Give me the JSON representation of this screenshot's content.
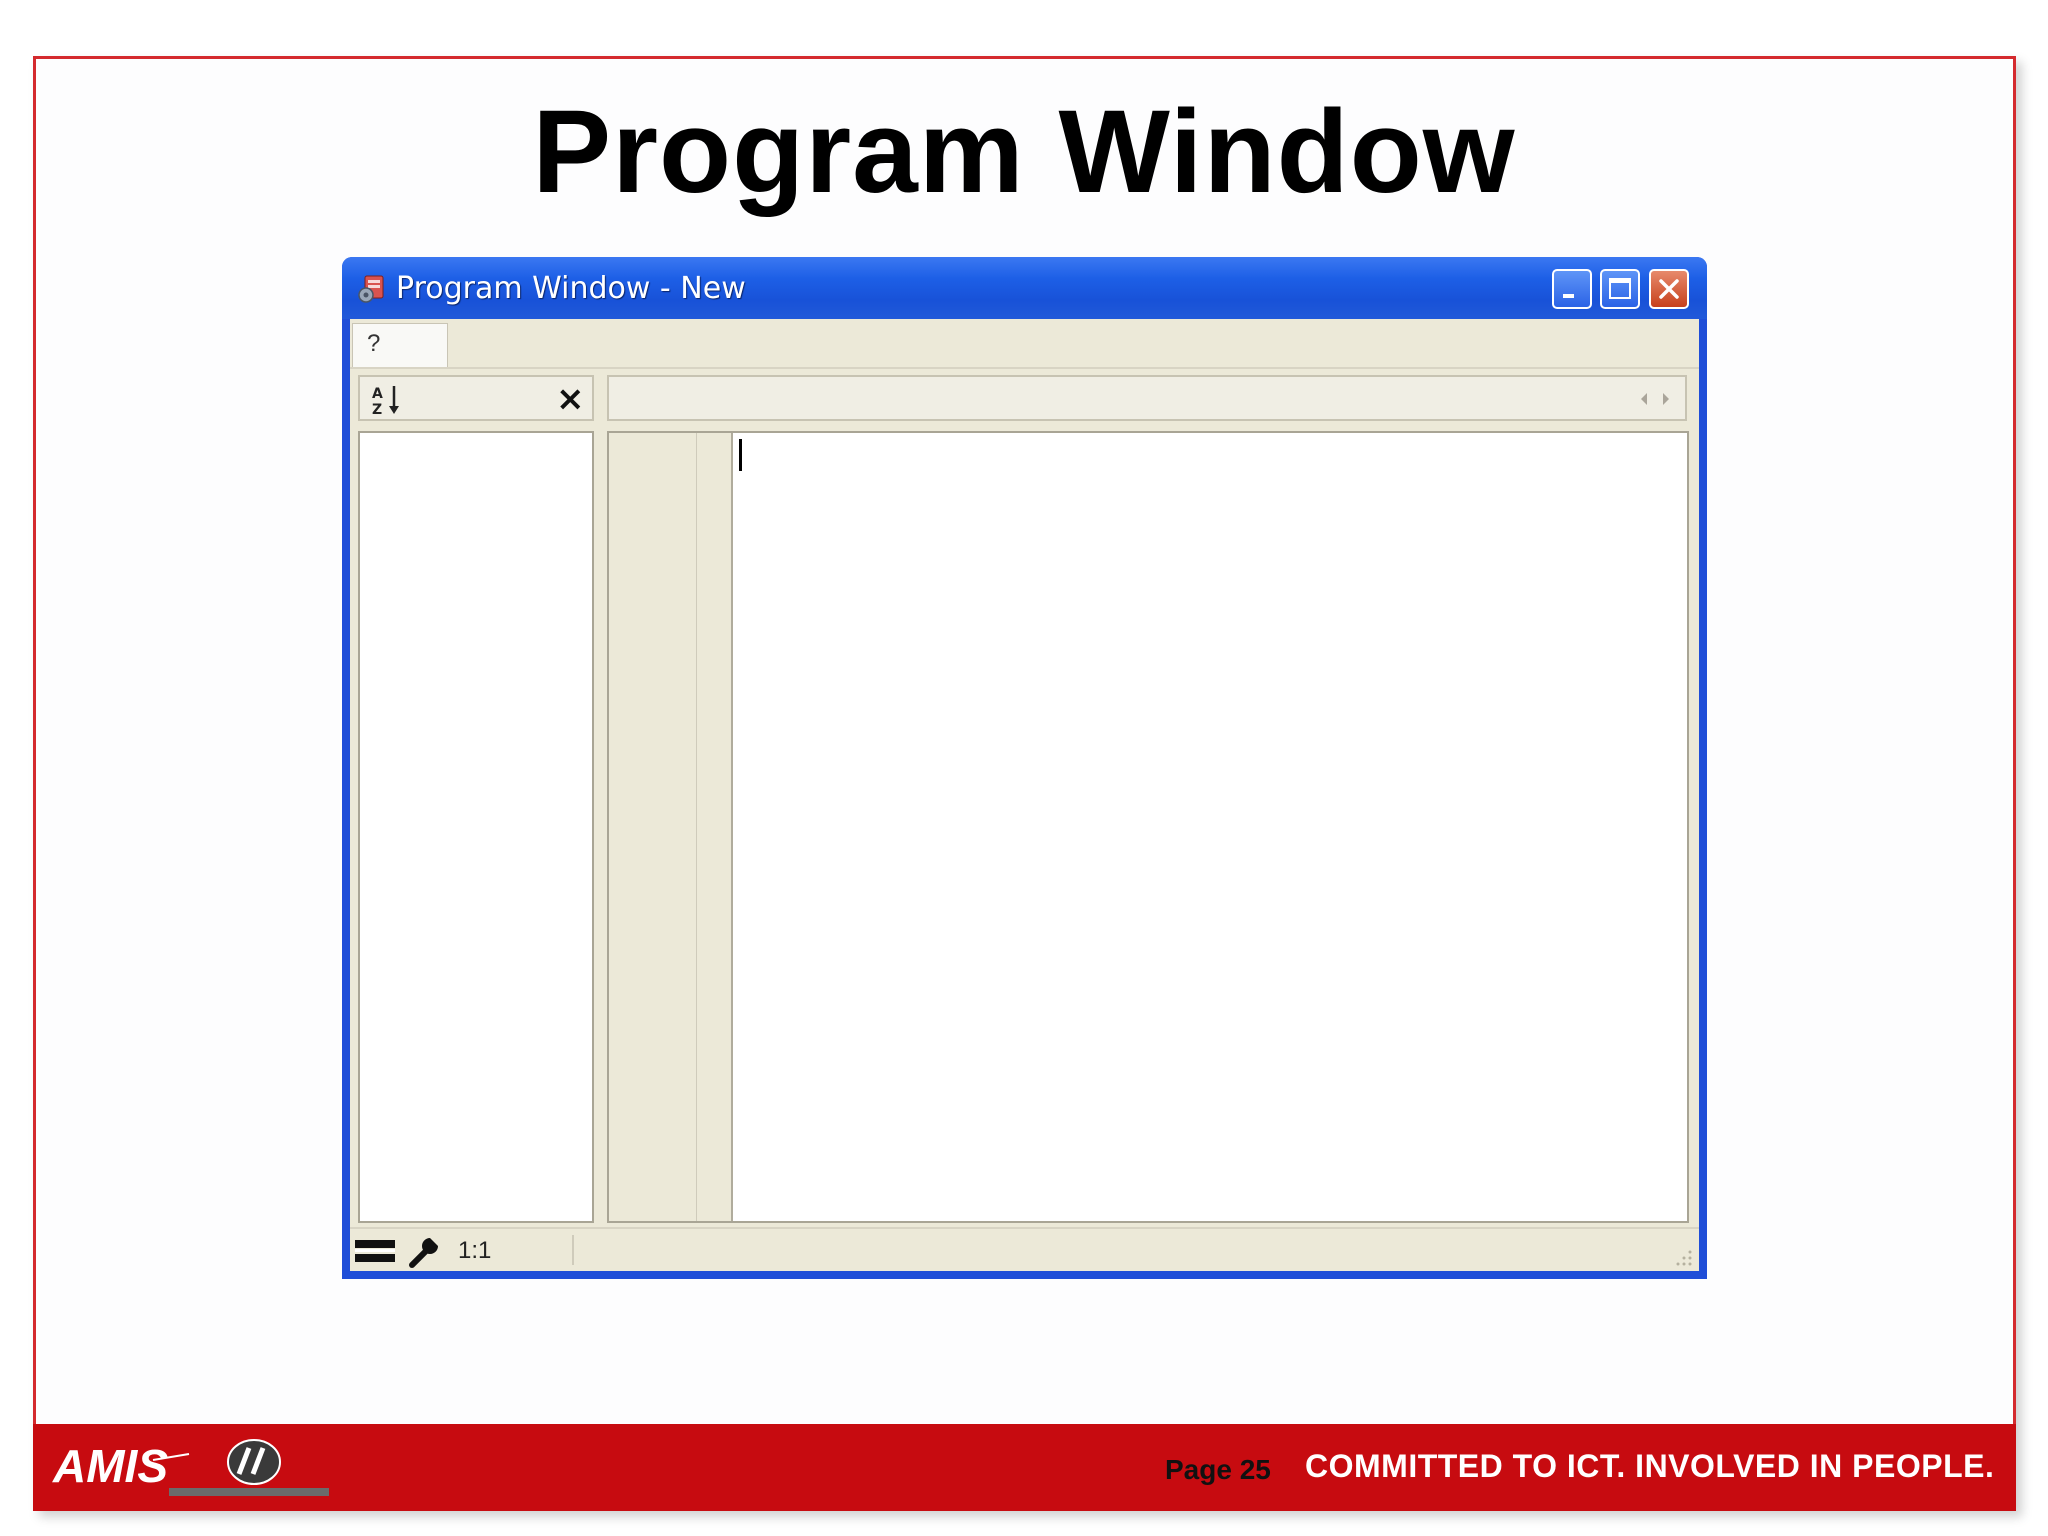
{
  "slide": {
    "title": "Program Window",
    "page_number": "Page 25",
    "slogan": "COMMITTED TO ICT.  INVOLVED IN PEOPLE.",
    "logo_text": "AMIS"
  },
  "window": {
    "title": "Program Window - New",
    "tabs": [
      {
        "label": "?"
      }
    ],
    "left_toolbar": {
      "sort_icon": "sort-az-icon",
      "close_label": "×"
    },
    "status": {
      "position": "1:1"
    }
  },
  "colors": {
    "frame_red": "#d42a2e",
    "footer_red": "#c70b10",
    "xp_blue": "#1f4ed8",
    "xp_face": "#ece9d8"
  }
}
